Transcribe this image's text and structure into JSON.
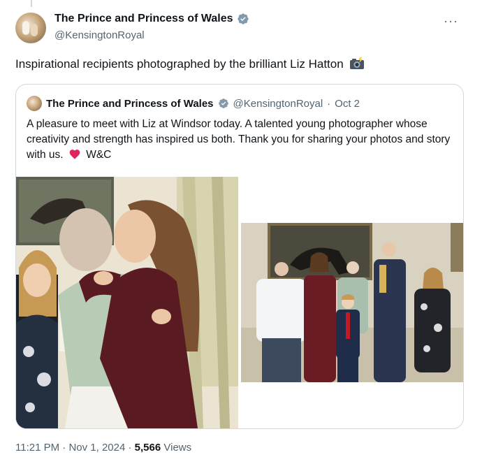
{
  "post": {
    "author_name": "The Prince and Princess of Wales",
    "author_handle": "@KensingtonRoyal",
    "text": "Inspirational recipients photographed by the brilliant Liz Hatton",
    "more_label": "···"
  },
  "quoted": {
    "author_name": "The Prince and Princess of Wales",
    "author_handle": "@KensingtonRoyal",
    "separator": "·",
    "date": "Oct 2",
    "text_before_heart": "A pleasure to meet with Liz at Windsor today. A talented young photographer whose creativity and strength has inspired us both. Thank you for sharing your photos and story with us.",
    "text_after_heart": "W&C"
  },
  "footer": {
    "time": "11:21 PM",
    "separator1": "·",
    "date": "Nov 1, 2024",
    "separator2": "·",
    "views_count": "5,566",
    "views_label": "Views"
  },
  "colors": {
    "text_primary": "#0f1419",
    "text_secondary": "#536471",
    "verified_badge": "#829aab",
    "border": "#cfd9de",
    "heart": "#e0245e"
  },
  "icons": {
    "verified": "verified-badge-icon",
    "camera": "camera-flash-icon",
    "heart": "red-heart-icon",
    "more": "more-options-icon"
  }
}
